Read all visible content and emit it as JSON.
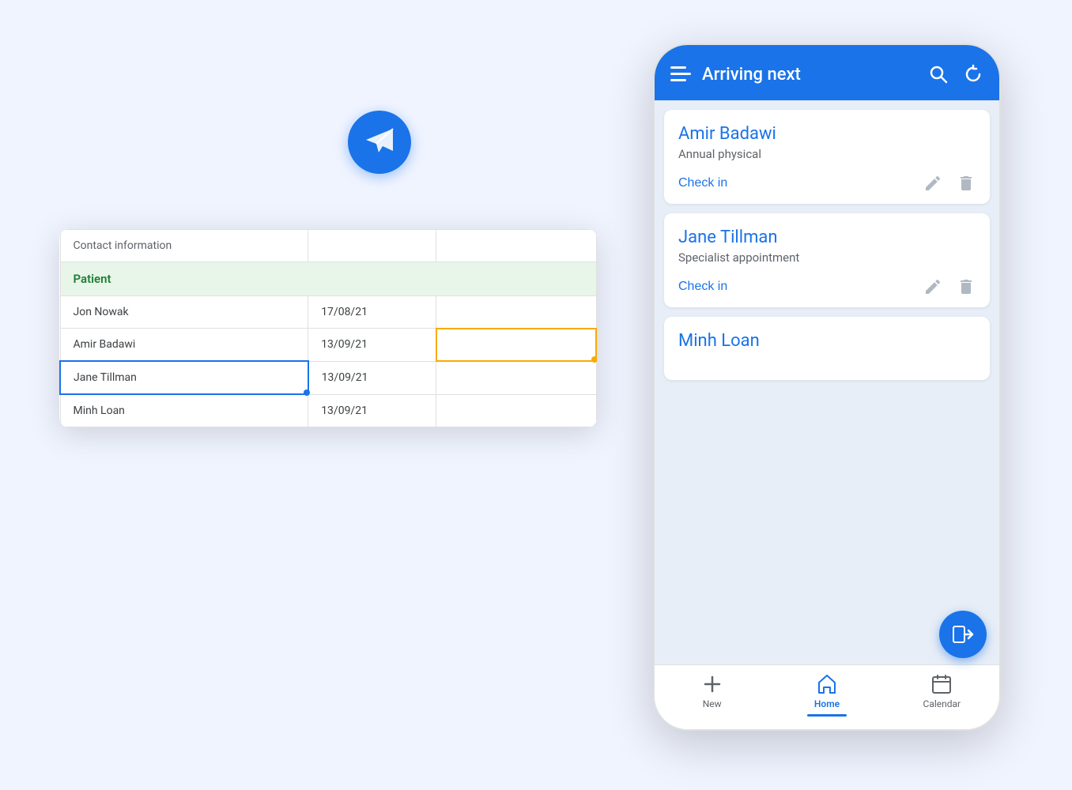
{
  "background": "#f0f4ff",
  "logo": {
    "icon": "paper-plane"
  },
  "spreadsheet": {
    "header_row": {
      "col1": "Contact information",
      "col2": "",
      "col3": ""
    },
    "section_label": "Patient",
    "rows": [
      {
        "name": "Jon Nowak",
        "date": "17/08/21",
        "col3": "",
        "state": "normal"
      },
      {
        "name": "Amir Badawi",
        "date": "13/09/21",
        "col3": "",
        "state": "yellow-selected"
      },
      {
        "name": "Jane Tillman",
        "date": "13/09/21",
        "col3": "",
        "state": "blue-selected"
      },
      {
        "name": "Minh Loan",
        "date": "13/09/21",
        "col3": "",
        "state": "normal"
      }
    ]
  },
  "phone": {
    "header": {
      "title": "Arriving next",
      "search_icon": "search",
      "refresh_icon": "refresh",
      "menu_icon": "hamburger"
    },
    "patients": [
      {
        "name": "Amir Badawi",
        "appointment_type": "Annual physical",
        "check_in_label": "Check in"
      },
      {
        "name": "Jane Tillman",
        "appointment_type": "Specialist appointment",
        "check_in_label": "Check in"
      },
      {
        "name": "Minh Loan",
        "appointment_type": "",
        "check_in_label": ""
      }
    ],
    "fab_icon": "login-arrow",
    "bottom_nav": [
      {
        "label": "New",
        "icon": "plus",
        "active": false
      },
      {
        "label": "Home",
        "icon": "home",
        "active": true
      },
      {
        "label": "Calendar",
        "icon": "calendar",
        "active": false
      }
    ]
  }
}
